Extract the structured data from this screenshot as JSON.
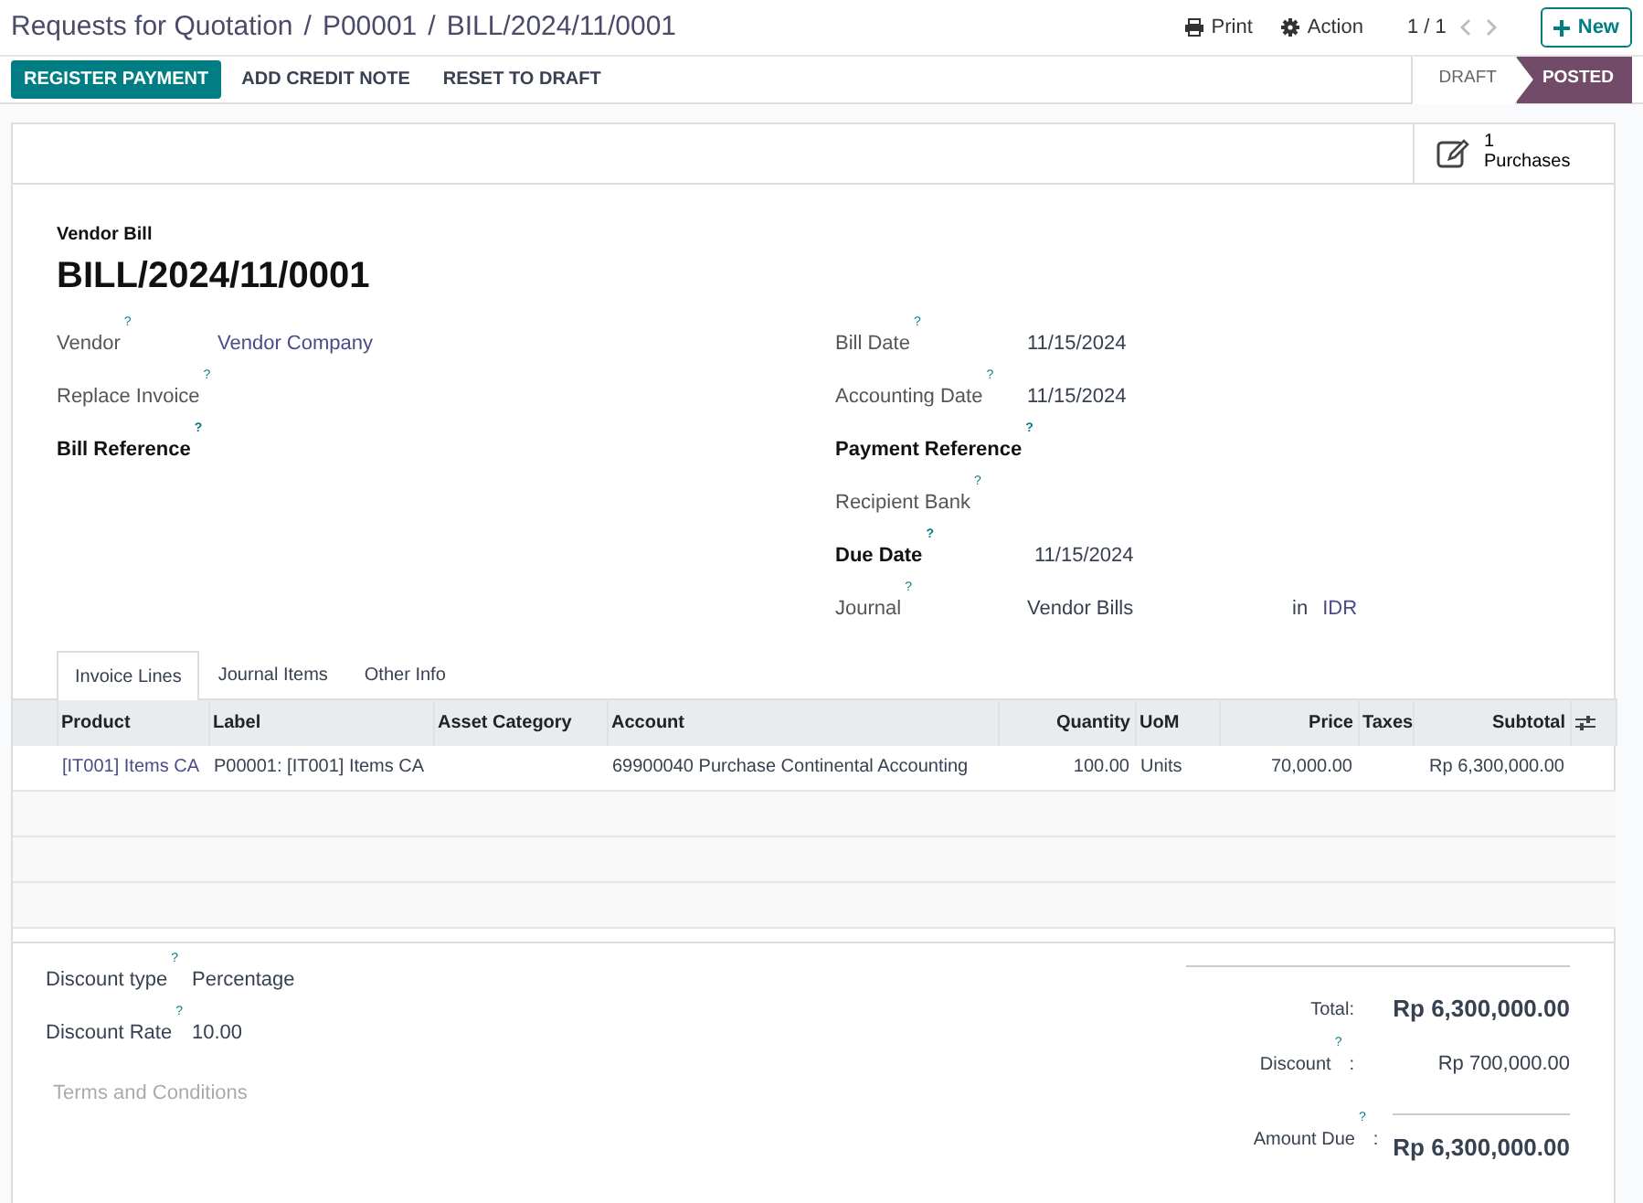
{
  "breadcrumbs": [
    "Requests for Quotation",
    "P00001",
    "BILL/2024/11/0001"
  ],
  "breadcrumb_separator": "/",
  "header_actions": {
    "print": "Print",
    "action": "Action",
    "pager": "1 / 1",
    "new": "New"
  },
  "buttons": [
    {
      "label": "REGISTER PAYMENT",
      "kind": "primary"
    },
    {
      "label": "ADD CREDIT NOTE",
      "kind": "secondary"
    },
    {
      "label": "RESET TO DRAFT",
      "kind": "secondary"
    }
  ],
  "status_stages": [
    {
      "label": "DRAFT",
      "selected": false
    },
    {
      "label": "POSTED",
      "selected": true
    }
  ],
  "smart_button": {
    "count": "1",
    "label": "Purchases"
  },
  "form": {
    "subtitle": "Vendor Bill",
    "title": "BILL/2024/11/0001",
    "left_fields": [
      {
        "label": "Vendor",
        "help": "?",
        "required": false,
        "value": "Vendor Company",
        "link": true
      },
      {
        "label": "Replace Invoice",
        "help": "?",
        "required": false
      },
      {
        "label": "Bill Reference",
        "help": "?",
        "required": true
      }
    ],
    "right_fields": [
      {
        "label": "Bill Date",
        "help": "?",
        "required": false,
        "value": "11/15/2024",
        "link": false
      },
      {
        "label": "Accounting Date",
        "help": "?",
        "required": false,
        "value": "11/15/2024",
        "link": false
      },
      {
        "label": "Payment Reference",
        "help": "?",
        "required": true
      },
      {
        "label": "Recipient Bank",
        "help": "?",
        "required": false
      },
      {
        "label": "Due Date",
        "help": "?",
        "required": true,
        "value": "11/15/2024",
        "link": false
      },
      {
        "label": "Journal",
        "help": "?",
        "required": false,
        "value": "Vendor Bills",
        "link": false,
        "joiner": "in",
        "currency": "IDR"
      }
    ]
  },
  "tabs": [
    {
      "label": "Invoice Lines",
      "selected": true
    },
    {
      "label": "Journal Items",
      "selected": false
    },
    {
      "label": "Other Info",
      "selected": false
    }
  ],
  "table": {
    "columns": [
      "Product",
      "Label",
      "Asset Category",
      "Account",
      "Quantity",
      "UoM",
      "Price",
      "Taxes",
      "Subtotal"
    ],
    "rows": [
      {
        "cells": [
          "[IT001] Items CA",
          "P00001: [IT001] Items CA",
          "",
          "69900040 Purchase Continental Accounting",
          "100.00",
          "Units",
          "70,000.00",
          "",
          "Rp 6,300,000.00"
        ]
      }
    ]
  },
  "bottom_fields": [
    {
      "label": "Discount type",
      "help": "?",
      "value": "Percentage"
    },
    {
      "label": "Discount Rate",
      "help": "?",
      "value": "10.00"
    }
  ],
  "terms_placeholder": "Terms and Conditions",
  "totals": [
    {
      "label": "Total:",
      "value": "Rp 6,300,000.00",
      "emphasis": true
    },
    {
      "label": "Discount",
      "help": "?",
      "suffix": ":",
      "value": "Rp 700,000.00",
      "emphasis": false
    },
    {
      "label": "Amount Due",
      "help": "?",
      "suffix": ":",
      "value": "Rp 6,300,000.00",
      "emphasis": true,
      "rule": true
    }
  ]
}
